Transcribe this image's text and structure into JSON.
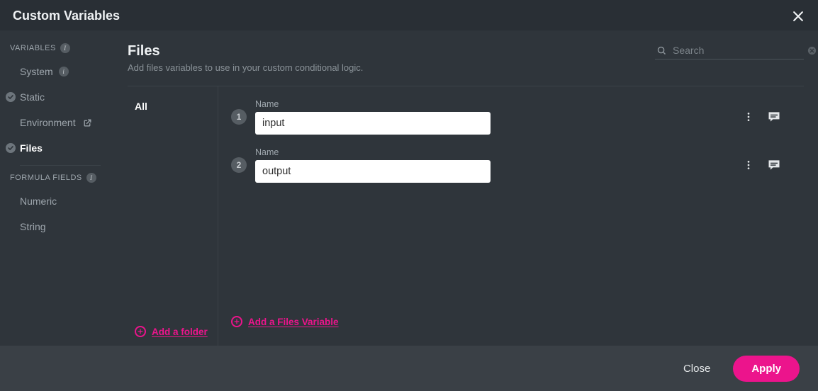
{
  "dialog": {
    "title": "Custom Variables"
  },
  "sidebar": {
    "section_variables": "VARIABLES",
    "section_formula": "FORMULA FIELDS",
    "items": {
      "system": "System",
      "static": "Static",
      "environment": "Environment",
      "files": "Files",
      "numeric": "Numeric",
      "string": "String"
    }
  },
  "main": {
    "title": "Files",
    "subtitle": "Add files variables to use in your custom conditional logic."
  },
  "search": {
    "placeholder": "Search",
    "value": ""
  },
  "folders": {
    "current": "All",
    "add_label": "Add a folder"
  },
  "variables": [
    {
      "index": "1",
      "name_label": "Name",
      "name_value": "input"
    },
    {
      "index": "2",
      "name_label": "Name",
      "name_value": "output"
    }
  ],
  "vars_footer": {
    "add_label": "Add a Files Variable"
  },
  "footer": {
    "close": "Close",
    "apply": "Apply"
  },
  "colors": {
    "accent": "#ec148c"
  }
}
